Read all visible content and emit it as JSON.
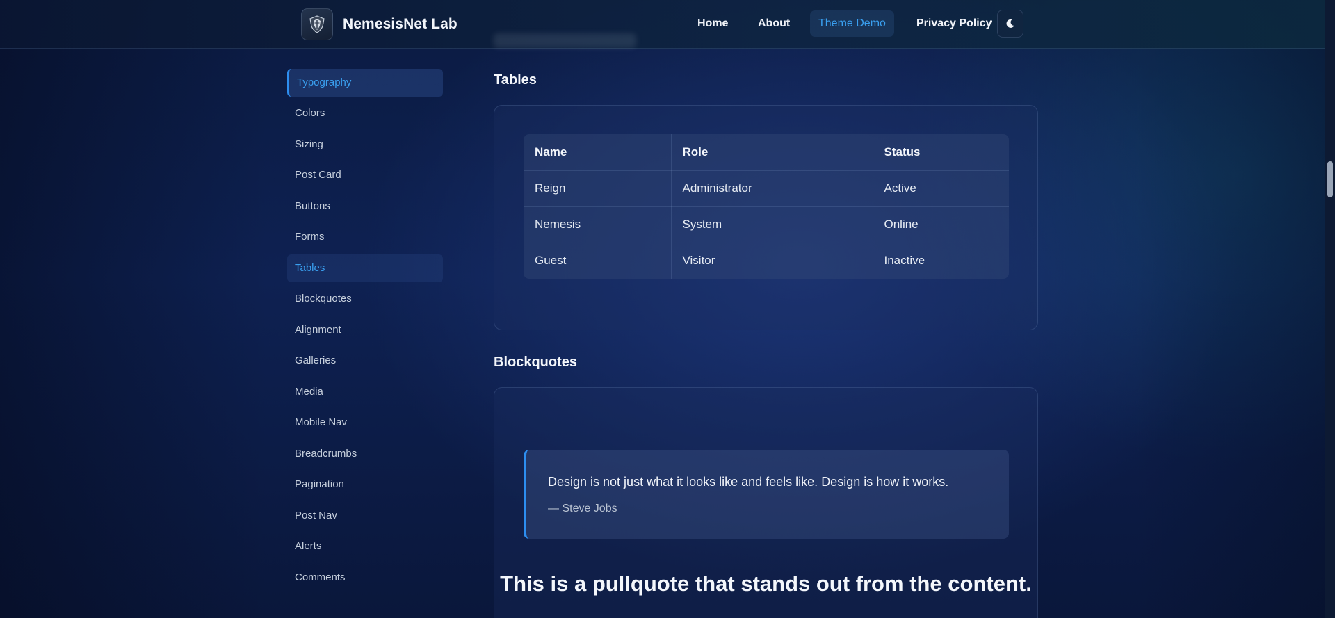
{
  "brand": {
    "name": "NemesisNet Lab",
    "logo_icon": "shield-emblem-icon"
  },
  "nav": {
    "items": [
      {
        "label": "Home"
      },
      {
        "label": "About"
      },
      {
        "label": "Theme Demo",
        "active": true
      },
      {
        "label": "Privacy Policy"
      }
    ],
    "theme_toggle_icon": "moon-icon"
  },
  "sidebar": {
    "items": [
      {
        "label": "Typography",
        "state": "current"
      },
      {
        "label": "Colors"
      },
      {
        "label": "Sizing"
      },
      {
        "label": "Post Card"
      },
      {
        "label": "Buttons"
      },
      {
        "label": "Forms"
      },
      {
        "label": "Tables",
        "state": "highlight"
      },
      {
        "label": "Blockquotes"
      },
      {
        "label": "Alignment"
      },
      {
        "label": "Galleries"
      },
      {
        "label": "Media"
      },
      {
        "label": "Mobile Nav"
      },
      {
        "label": "Breadcrumbs"
      },
      {
        "label": "Pagination"
      },
      {
        "label": "Post Nav"
      },
      {
        "label": "Alerts"
      },
      {
        "label": "Comments"
      }
    ]
  },
  "tables_section": {
    "title": "Tables",
    "columns": [
      "Name",
      "Role",
      "Status"
    ],
    "rows": [
      [
        "Reign",
        "Administrator",
        "Active"
      ],
      [
        "Nemesis",
        "System",
        "Online"
      ],
      [
        "Guest",
        "Visitor",
        "Inactive"
      ]
    ]
  },
  "blockquotes_section": {
    "title": "Blockquotes",
    "quote": "Design is not just what it looks like and feels like. Design is how it works.",
    "cite": "— Steve Jobs",
    "pullquote": "This is a pullquote that stands out from the content."
  },
  "colors": {
    "accent": "#2d8ef0",
    "link_active": "#3aa0f0",
    "background": "#0e2152"
  }
}
